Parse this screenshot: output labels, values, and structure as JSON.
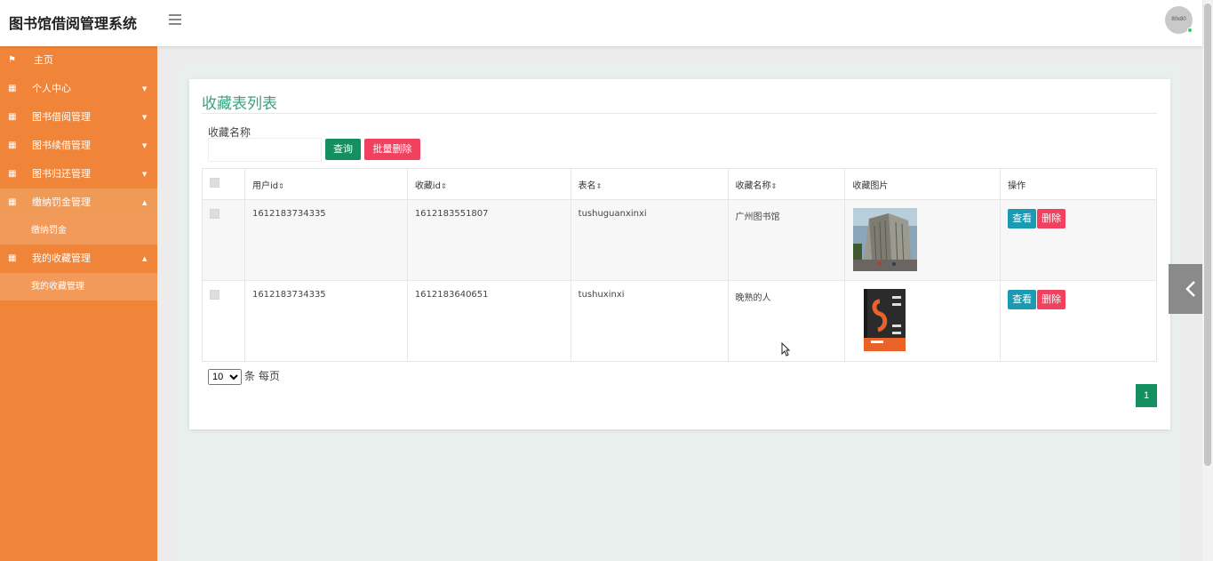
{
  "header": {
    "brand": "图书馆借阅管理系统",
    "avatar_text": "80x80"
  },
  "sidebar": {
    "items": [
      {
        "label": "主页",
        "icon": "flag-icon"
      },
      {
        "label": "个人中心",
        "icon": "grid-icon"
      },
      {
        "label": "图书借阅管理",
        "icon": "grid-icon"
      },
      {
        "label": "图书续借管理",
        "icon": "grid-icon"
      },
      {
        "label": "图书归还管理",
        "icon": "grid-icon"
      },
      {
        "label": "缴纳罚金管理",
        "icon": "grid-icon",
        "active": true,
        "sub": "缴纳罚金"
      },
      {
        "label": "我的收藏管理",
        "icon": "grid-icon",
        "sub": "我的收藏管理"
      }
    ]
  },
  "main": {
    "title": "收藏表列表",
    "search_label": "收藏名称",
    "search_value": "",
    "query_button": "查询",
    "batch_delete_button": "批量删除",
    "columns": [
      "用户id",
      "收藏id",
      "表名",
      "收藏名称",
      "收藏图片",
      "操作"
    ],
    "rows": [
      {
        "user_id": "1612183734335",
        "fav_id": "1612183551807",
        "table": "tushuguanxinxi",
        "name": "广州图书馆",
        "image": "library-building-photo"
      },
      {
        "user_id": "1612183734335",
        "fav_id": "1612183640651",
        "table": "tushuxinxi",
        "name": "晚熟的人",
        "image": "book-cover-photo"
      }
    ],
    "view_button": "查看",
    "delete_button": "删除",
    "page_size": "10",
    "page_size_suffix": "条 每页",
    "current_page": "1"
  },
  "colors": {
    "sidebar": "#f0853a",
    "title": "#3aa37c",
    "primary": "#148f5f",
    "danger": "#f0415e",
    "info": "#1b9bb3"
  }
}
